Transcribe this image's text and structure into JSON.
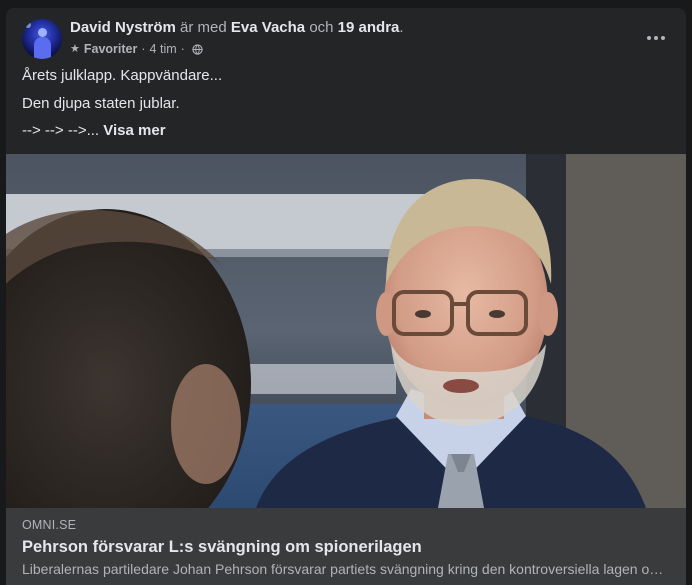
{
  "post": {
    "author": "David Nyström",
    "is_with": "är med",
    "tagged_person": "Eva Vacha",
    "and_word": "och",
    "others": "19 andra",
    "period": ".",
    "audience_label": "Favoriter",
    "separator": "·",
    "timestamp": "4 tim",
    "audience_icon": "globe-icon",
    "favorites_icon": "star-icon",
    "menu_icon": "more-options-icon",
    "lines": [
      "Årets julklapp. Kappvändare...",
      "Den djupa staten jublar.",
      "--> --> -->..."
    ],
    "see_more": "Visa mer"
  },
  "link_preview": {
    "domain": "OMNI.SE",
    "title": "Pehrson försvarar L:s svängning om spionerilagen",
    "description": "Liberalernas partiledare Johan Pehrson försvarar partiets svängning kring den kontroversiella lagen om utlandsspionage."
  },
  "colors": {
    "card_background": "#242526",
    "page_background": "#18191a",
    "link_footer_background": "#3a3b3c",
    "primary_text": "#e4e6eb",
    "secondary_text": "#b0b3b8"
  }
}
